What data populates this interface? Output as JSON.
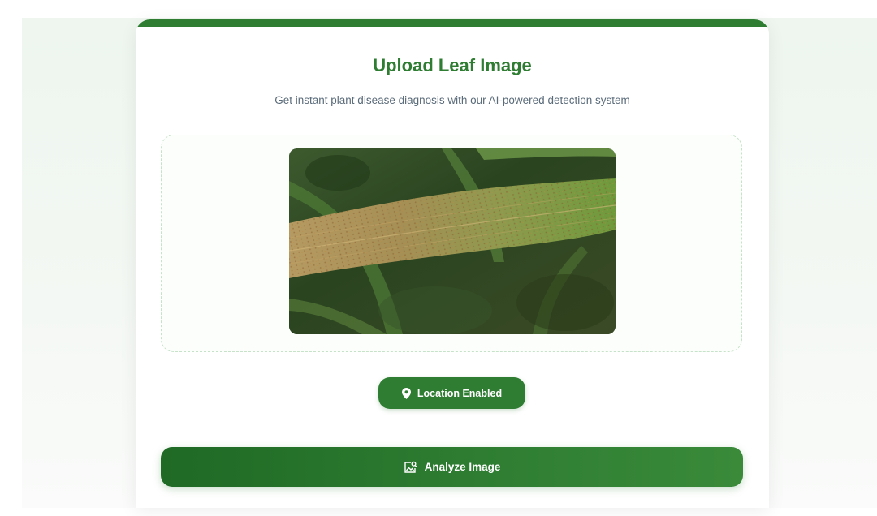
{
  "card": {
    "title": "Upload Leaf Image",
    "subtitle": "Get instant plant disease diagnosis with our AI-powered detection system"
  },
  "upload": {
    "preview_image": "leaf-with-rust-disease-photo"
  },
  "location_button": {
    "label": "Location Enabled",
    "icon": "map-pin-icon"
  },
  "analyze_button": {
    "label": "Analyze Image",
    "icon": "image-search-icon"
  },
  "colors": {
    "brand_green": "#2e7d32",
    "subtitle_gray": "#5a6b7a",
    "dropzone_border": "#c6e2c8",
    "page_bg": "#eef6ef"
  }
}
